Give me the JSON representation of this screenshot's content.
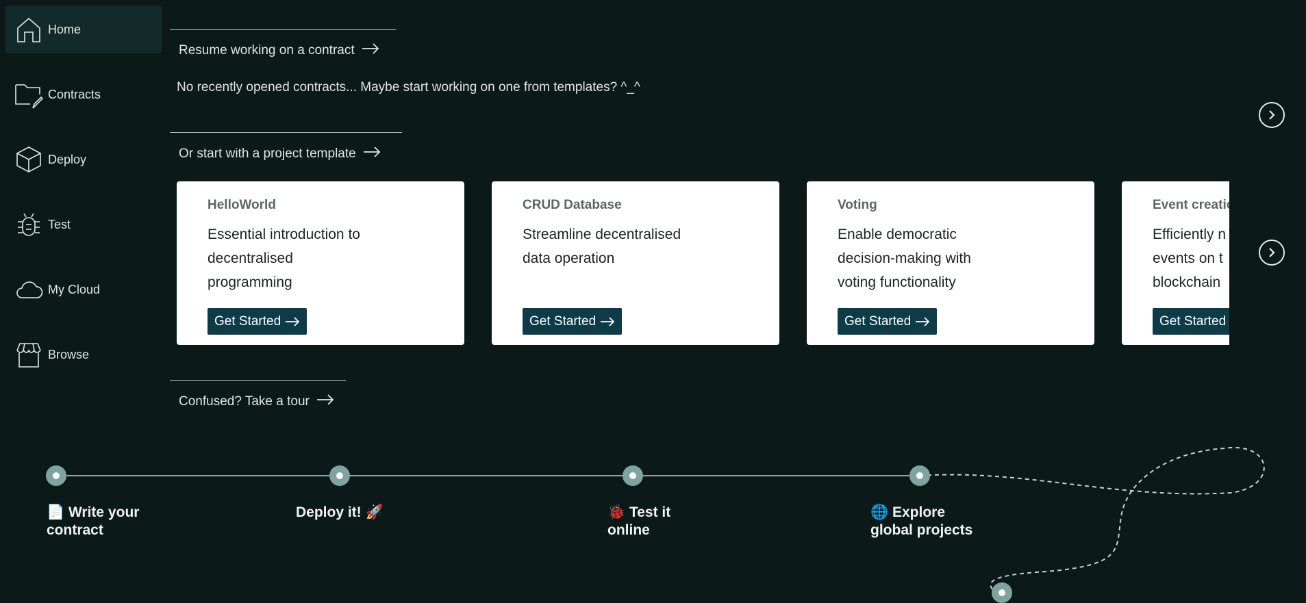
{
  "sidebar": {
    "items": [
      {
        "label": "Home",
        "icon": "home-icon"
      },
      {
        "label": "Contracts",
        "icon": "folder-edit-icon"
      },
      {
        "label": "Deploy",
        "icon": "cube-icon"
      },
      {
        "label": "Test",
        "icon": "bug-icon"
      },
      {
        "label": "My Cloud",
        "icon": "cloud-icon"
      },
      {
        "label": "Browse",
        "icon": "store-icon"
      }
    ]
  },
  "resume": {
    "title": "Resume working on a contract",
    "empty_message": "No recently opened contracts... Maybe start working on one from templates? ^_^"
  },
  "templates": {
    "title": "Or start with a project template",
    "cards": [
      {
        "title": "HelloWorld",
        "description": "Essential introduction to decentralised programming",
        "button": "Get Started"
      },
      {
        "title": "CRUD Database",
        "description": "Streamline decentralised data operation",
        "button": "Get Started"
      },
      {
        "title": "Voting",
        "description": "Enable democratic decision-making with voting functionality",
        "button": "Get Started"
      },
      {
        "title": "Event creatio",
        "description": "Efficiently n events on t blockchain",
        "button": "Get Started"
      }
    ]
  },
  "tour": {
    "title": "Confused? Take a tour",
    "steps": [
      {
        "line1": "📄 Write your",
        "line2": "contract"
      },
      {
        "line1": "Deploy it! 🚀",
        "line2": ""
      },
      {
        "line1": "🐞 Test it",
        "line2": "online"
      },
      {
        "line1": "🌐 Explore",
        "line2": "global projects"
      }
    ]
  },
  "colors": {
    "background": "#0c1919",
    "sidebar_active": "#132a2a",
    "button": "#0e3b48",
    "dot": "#7fa39d"
  }
}
